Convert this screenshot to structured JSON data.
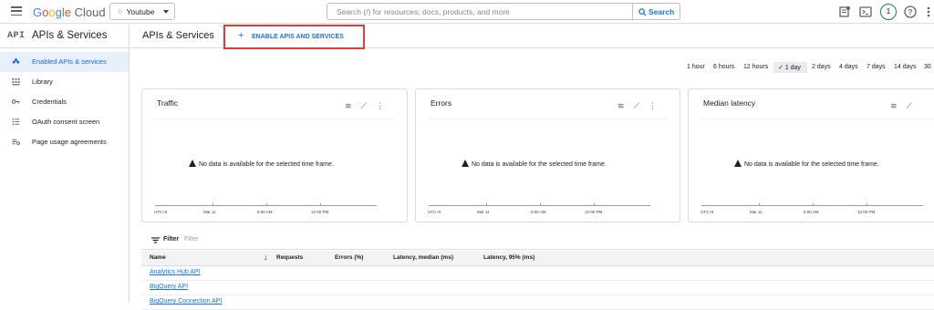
{
  "topbar": {
    "logo_google": "Google",
    "logo_cloud": "Cloud",
    "project": "Youtube",
    "search_placeholder": "Search (/) for resources, docs, products, and more",
    "search_button": "Search",
    "avatar_letter": "1"
  },
  "sidebar": {
    "api_badge": "API",
    "title": "APIs & Services",
    "items": [
      {
        "label": "Enabled APIs & services",
        "icon": "api-diamond-icon",
        "active": true
      },
      {
        "label": "Library",
        "icon": "library-icon",
        "active": false
      },
      {
        "label": "Credentials",
        "icon": "key-icon",
        "active": false
      },
      {
        "label": "OAuth consent screen",
        "icon": "consent-icon",
        "active": false
      },
      {
        "label": "Page usage agreements",
        "icon": "settings-list-icon",
        "active": false
      }
    ]
  },
  "main": {
    "title": "APIs & Services",
    "enable_button": "ENABLE APIS AND SERVICES"
  },
  "time_ranges": {
    "items": [
      "1 hour",
      "6 hours",
      "12 hours",
      "1 day",
      "2 days",
      "4 days",
      "7 days",
      "14 days",
      "30"
    ],
    "selected": "1 day"
  },
  "cards": [
    {
      "title": "Traffic",
      "message": "No data is available for the selected time frame.",
      "axis": [
        "UTC+6",
        "Mar 11",
        "6:00 AM",
        "12:00 PM"
      ]
    },
    {
      "title": "Errors",
      "message": "No data is available for the selected time frame.",
      "axis": [
        "UTC+6",
        "Mar 11",
        "6:00 AM",
        "12:00 PM"
      ]
    },
    {
      "title": "Median latency",
      "message": "No data is available for the selected time frame.",
      "axis": [
        "UTC+6",
        "Mar 11",
        "6:00 AM",
        "12:00 PM"
      ]
    }
  ],
  "table": {
    "filter_label": "Filter",
    "filter_placeholder": "Filter",
    "columns": [
      "Name",
      "Requests",
      "Errors (%)",
      "Latency, median (ms)",
      "Latency, 95% (ms)"
    ],
    "rows": [
      "Analytics Hub API",
      "BigQuery API",
      "BigQuery Connection API"
    ]
  },
  "colors": {
    "accent": "#1a73e8",
    "highlight_border": "#e53935",
    "active_bg": "#e8f0fe"
  }
}
